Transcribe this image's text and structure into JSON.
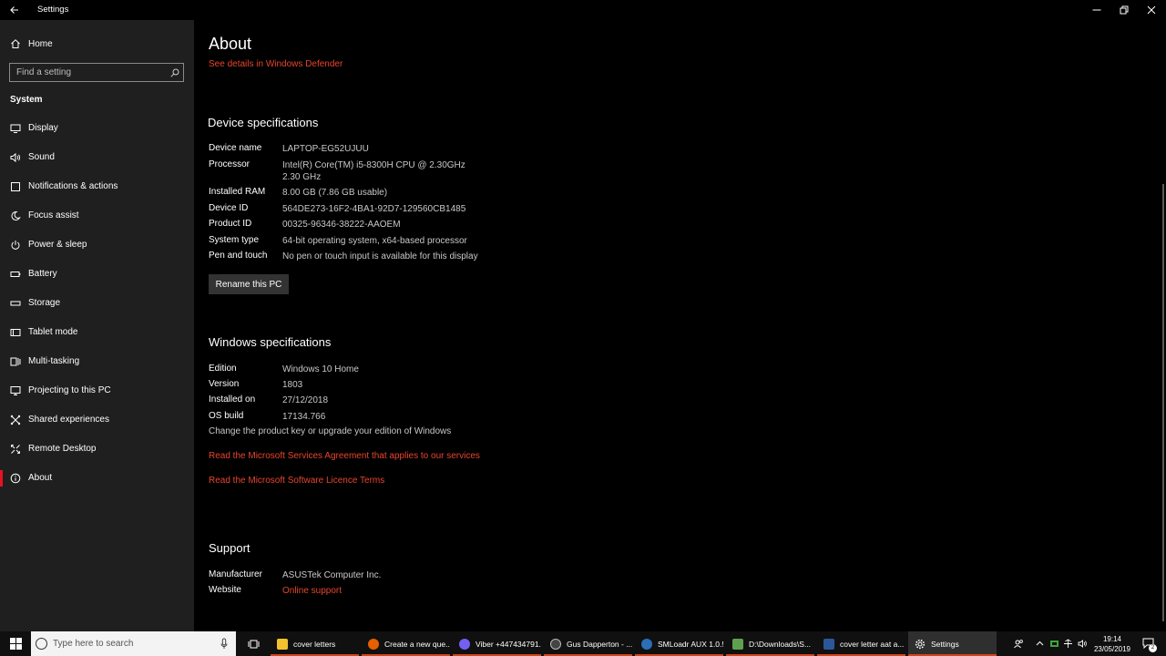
{
  "window": {
    "title": "Settings"
  },
  "sidebar": {
    "home_label": "Home",
    "search_placeholder": "Find a setting",
    "section_title": "System",
    "items": [
      {
        "label": "Display",
        "icon": "monitor-icon"
      },
      {
        "label": "Sound",
        "icon": "speaker-icon"
      },
      {
        "label": "Notifications & actions",
        "icon": "notification-icon"
      },
      {
        "label": "Focus assist",
        "icon": "moon-icon"
      },
      {
        "label": "Power & sleep",
        "icon": "power-icon"
      },
      {
        "label": "Battery",
        "icon": "battery-icon"
      },
      {
        "label": "Storage",
        "icon": "storage-icon"
      },
      {
        "label": "Tablet mode",
        "icon": "tablet-icon"
      },
      {
        "label": "Multi-tasking",
        "icon": "multitasking-icon"
      },
      {
        "label": "Projecting to this PC",
        "icon": "projector-icon"
      },
      {
        "label": "Shared experiences",
        "icon": "shared-icon"
      },
      {
        "label": "Remote Desktop",
        "icon": "remote-desktop-icon"
      },
      {
        "label": "About",
        "icon": "info-icon",
        "active": true
      }
    ]
  },
  "about": {
    "title": "About",
    "defender_link": "See details in Windows Defender",
    "device_specs": {
      "heading": "Device specifications",
      "rows": [
        {
          "key": "Device name",
          "value": "LAPTOP-EG52UJUU"
        },
        {
          "key": "Processor",
          "value": "Intel(R) Core(TM) i5-8300H CPU @ 2.30GHz",
          "value2": "2.30 GHz"
        },
        {
          "key": "Installed RAM",
          "value": "8.00 GB (7.86 GB usable)"
        },
        {
          "key": "Device ID",
          "value": "564DE273-16F2-4BA1-92D7-129560CB1485"
        },
        {
          "key": "Product ID",
          "value": "00325-96346-38222-AAOEM"
        },
        {
          "key": "System type",
          "value": "64-bit operating system, x64-based processor"
        },
        {
          "key": "Pen and touch",
          "value": "No pen or touch input is available for this display"
        }
      ],
      "rename_button": "Rename this PC"
    },
    "windows_specs": {
      "heading": "Windows specifications",
      "rows": [
        {
          "key": "Edition",
          "value": "Windows 10 Home"
        },
        {
          "key": "Version",
          "value": "1803"
        },
        {
          "key": "Installed on",
          "value": "27/12/2018"
        },
        {
          "key": "OS build",
          "value": "17134.766"
        }
      ],
      "product_key_text": "Change the product key or upgrade your edition of Windows",
      "services_link": "Read the Microsoft Services Agreement that applies to our services",
      "licence_link": "Read the Microsoft Software Licence Terms"
    },
    "support": {
      "heading": "Support",
      "manufacturer_key": "Manufacturer",
      "manufacturer_value": "ASUSTek Computer Inc.",
      "website_key": "Website",
      "website_link": "Online support"
    }
  },
  "taskbar": {
    "search_placeholder": "Type here to search",
    "apps": [
      {
        "label": "cover letters",
        "icon": "folder-icon",
        "color": "#f2c12e"
      },
      {
        "label": "Create a new que...",
        "icon": "firefox-icon",
        "color": "#e66000"
      },
      {
        "label": "Viber +447434791...",
        "icon": "viber-icon",
        "color": "#7360f2"
      },
      {
        "label": "Gus Dapperton - ...",
        "icon": "media-player-icon",
        "color": "#444444"
      },
      {
        "label": "SMLoadr AUX 1.0.5",
        "icon": "smloadr-icon",
        "color": "#2a6fb8"
      },
      {
        "label": "D:\\Downloads\\S...",
        "icon": "node-icon",
        "color": "#5fa04e"
      },
      {
        "label": "cover letter aat a...",
        "icon": "word-icon",
        "color": "#2b579a"
      },
      {
        "label": "Settings",
        "icon": "settings-gear-icon",
        "color": "#2f2f2f",
        "active": true
      }
    ],
    "clock_time": "19:14",
    "clock_date": "23/05/2019",
    "notification_count": "2"
  },
  "colors": {
    "accent_link": "#e8452c",
    "active_indicator": "#e81123",
    "sidebar_bg": "#1f1f1f",
    "content_bg": "#000000"
  }
}
